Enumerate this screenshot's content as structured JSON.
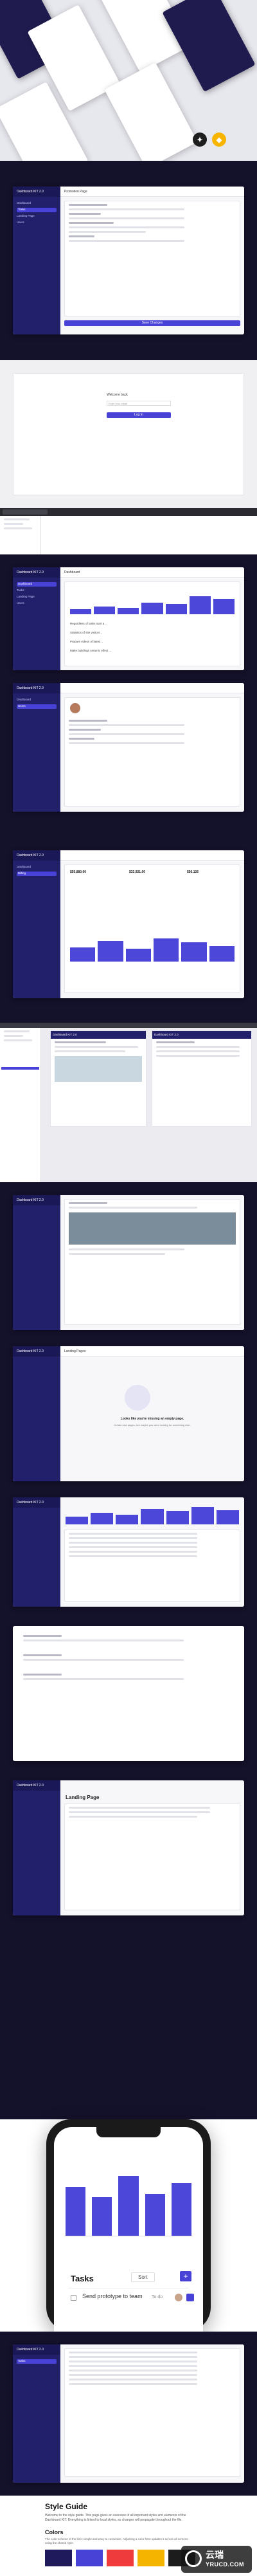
{
  "hero": {
    "tool_icons": [
      "figma-icon",
      "sketch-icon"
    ],
    "colors": {
      "figma": "#1e1e1e",
      "sketch": "#f7b500"
    }
  },
  "brand": {
    "name": "Dashboard KIT 2.0"
  },
  "sidebar": {
    "items": [
      "Dashboard",
      "Tasks",
      "Landing Page",
      "Users",
      "Settings",
      "Billing"
    ]
  },
  "modal_form": {
    "title": "Promotion Page",
    "save_label": "Save Changes"
  },
  "login": {
    "title": "Welcome back",
    "email_placeholder": "Enter your email",
    "button_label": "Log In"
  },
  "dashboard": {
    "page_title": "Dashboard",
    "stats": [
      "$55,880.00",
      "$32,921.00",
      "$56,126"
    ],
    "list_items": [
      "Regardless of tasks start a ..",
      "Statistics of site visitors ..",
      "Prepare videos of latest ..",
      "Make buildings ceramic effect ..."
    ]
  },
  "feed": {
    "title": "Landing Pages",
    "empty_title": "Looks like you're missing an empty page.",
    "empty_sub": "Create new pages, but maybe you were looking for something else."
  },
  "landing": {
    "title": "Landing Page"
  },
  "phone": {
    "tasks_title": "Tasks",
    "sort_label": "Sort",
    "add_label": "+",
    "task_text": "Send prototype to team",
    "task_status": "To do"
  },
  "style_guide": {
    "title": "Style Guide",
    "intro": "Welcome to the style guide. This page gives an overview of all important styles and elements of the Dashboard KIT. Everything is linked to local styles, so changes will propagate throughout the file.",
    "colors_title": "Colors",
    "colors_intro": "The color scheme of the kit is simple and easy to customize. Adjusting a color here updates it across all screens using the shared style.",
    "swatches": [
      "#1f1a5c",
      "#4942d6",
      "#ef3b3b",
      "#f4b400",
      "#1c1c1c",
      "#f2f2f2"
    ]
  },
  "watermark": {
    "cn": "云瑞",
    "url": "YRUCD.COM"
  }
}
